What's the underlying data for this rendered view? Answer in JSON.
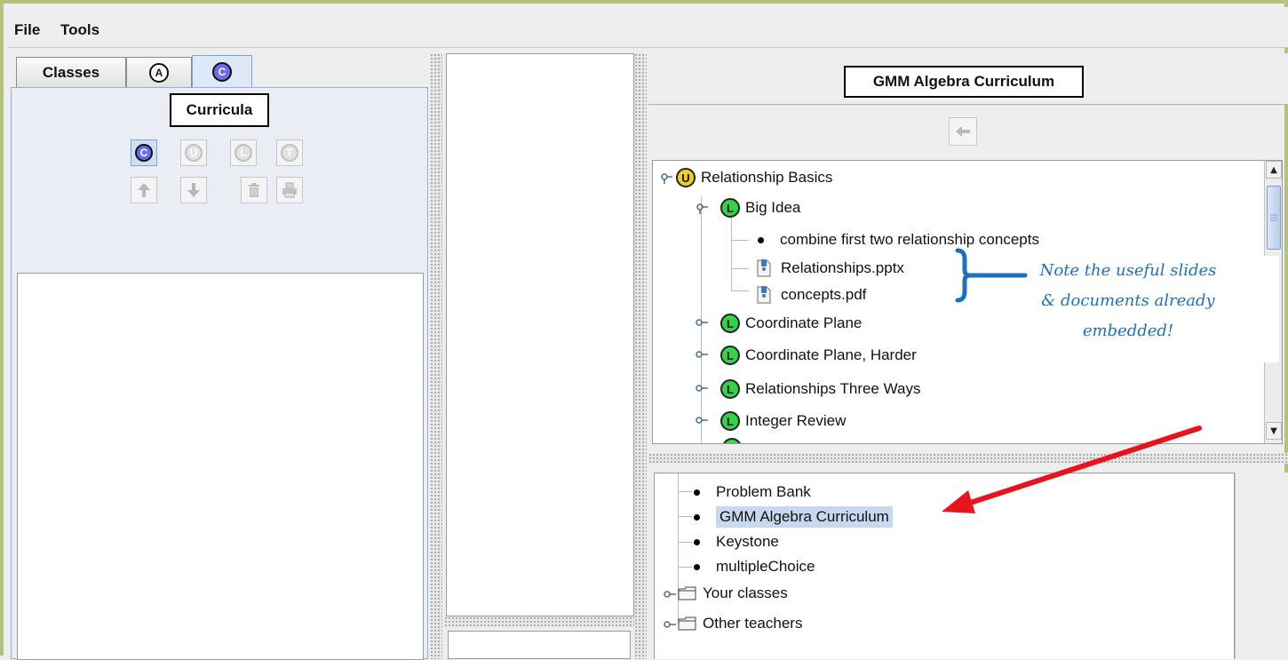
{
  "menu": {
    "file": "File",
    "tools": "Tools"
  },
  "left_panel": {
    "tabs": [
      {
        "label": "Classes"
      },
      {
        "label": "A"
      },
      {
        "label": "C"
      }
    ],
    "title": "Curricula",
    "toolbar_row1": [
      "C",
      "U",
      "L",
      "T"
    ]
  },
  "right_panel": {
    "title": "GMM Algebra Curriculum",
    "tree": [
      {
        "label": "Relationship Basics",
        "icon": "U"
      },
      {
        "label": "Big Idea",
        "icon": "L"
      },
      {
        "label": "combine first two relationship concepts"
      },
      {
        "label": "Relationships.pptx"
      },
      {
        "label": "concepts.pdf"
      },
      {
        "label": "Coordinate Plane",
        "icon": "L"
      },
      {
        "label": "Coordinate Plane, Harder",
        "icon": "L"
      },
      {
        "label": "Relationships Three Ways",
        "icon": "L"
      },
      {
        "label": "Integer Review",
        "icon": "L"
      }
    ],
    "curricula_list": [
      {
        "label": "Problem Bank"
      },
      {
        "label": "GMM Algebra Curriculum",
        "selected": true
      },
      {
        "label": "Keystone"
      },
      {
        "label": "multipleChoice"
      },
      {
        "label": "Your classes"
      },
      {
        "label": "Other teachers"
      }
    ]
  },
  "annotation": {
    "line1": "Note the useful slides",
    "line2": "& documents already",
    "line3": "embedded!"
  },
  "colors": {
    "frame": "#b5c27e",
    "lesson_green": "#34d34a",
    "unit_yellow": "#f2cf1e",
    "curriculum_blue": "#6b6bf0",
    "annotation_blue": "#1f6fc1",
    "arrow_red": "#e8141c",
    "selection": "#c7d9ee"
  }
}
